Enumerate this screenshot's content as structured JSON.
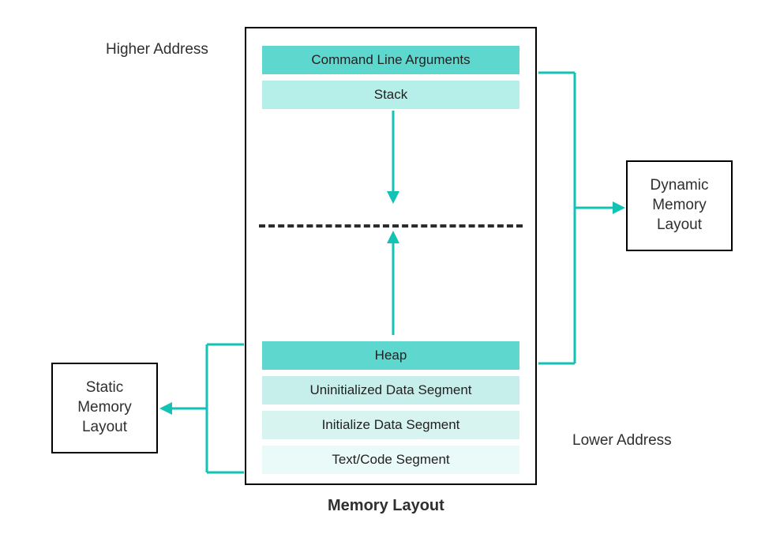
{
  "labels": {
    "higher_address": "Higher Address",
    "lower_address": "Lower Address",
    "caption": "Memory Layout",
    "static_box": "Static Memory Layout",
    "dynamic_box": "Dynamic Memory Layout"
  },
  "segments": {
    "cli": "Command Line Arguments",
    "stack": "Stack",
    "heap": "Heap",
    "uds": "Uninitialized Data Segment",
    "ids": "Initialize Data Segment",
    "text": "Text/Code Segment"
  },
  "colors": {
    "teal": "#12c2b5",
    "seg_dark": "#5ed7cf",
    "seg_mid": "#b6eee9",
    "seg_light": "#e9faf8"
  }
}
